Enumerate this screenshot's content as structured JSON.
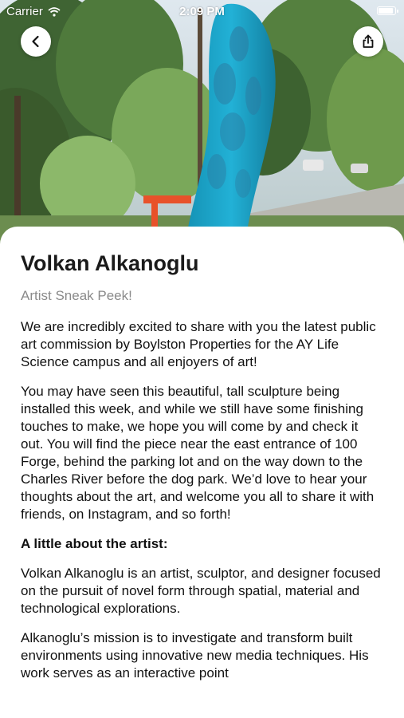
{
  "status_bar": {
    "carrier": "Carrier",
    "time": "2:09 PM"
  },
  "hero": {
    "description_icon": "sculpture-photo"
  },
  "nav": {
    "back_icon": "chevron-left-icon",
    "share_icon": "share-icon"
  },
  "article": {
    "title": "Volkan Alkanoglu",
    "subtitle": "Artist Sneak Peek!",
    "paragraphs": [
      "We are incredibly excited to share with you the latest public art commission by Boylston Properties for the AY Life Science campus and all enjoyers of art!",
      "You may have seen this beautiful, tall sculpture being installed this week, and while we still have some finishing touches to make, we hope you will come by and check it out. You will find the piece near the east entrance of 100 Forge, behind the parking lot and on the way down to the Charles River before the dog park. We’d love to hear your thoughts about the art, and welcome you all to share it with friends, on Instagram, and so forth!"
    ],
    "section_heading": "A little about the artist:",
    "artist_paragraphs": [
      "Volkan Alkanoglu is an artist, sculptor, and designer focused on the pursuit of novel form through spatial, material and technological explorations.",
      "Alkanoglu’s mission is to investigate and transform built environments using innovative new media techniques. His work serves as an interactive point"
    ]
  },
  "colors": {
    "sculpture": "#1fa5c9",
    "card_background": "#ffffff",
    "subtitle": "#8a8a8a",
    "text": "#111111"
  }
}
